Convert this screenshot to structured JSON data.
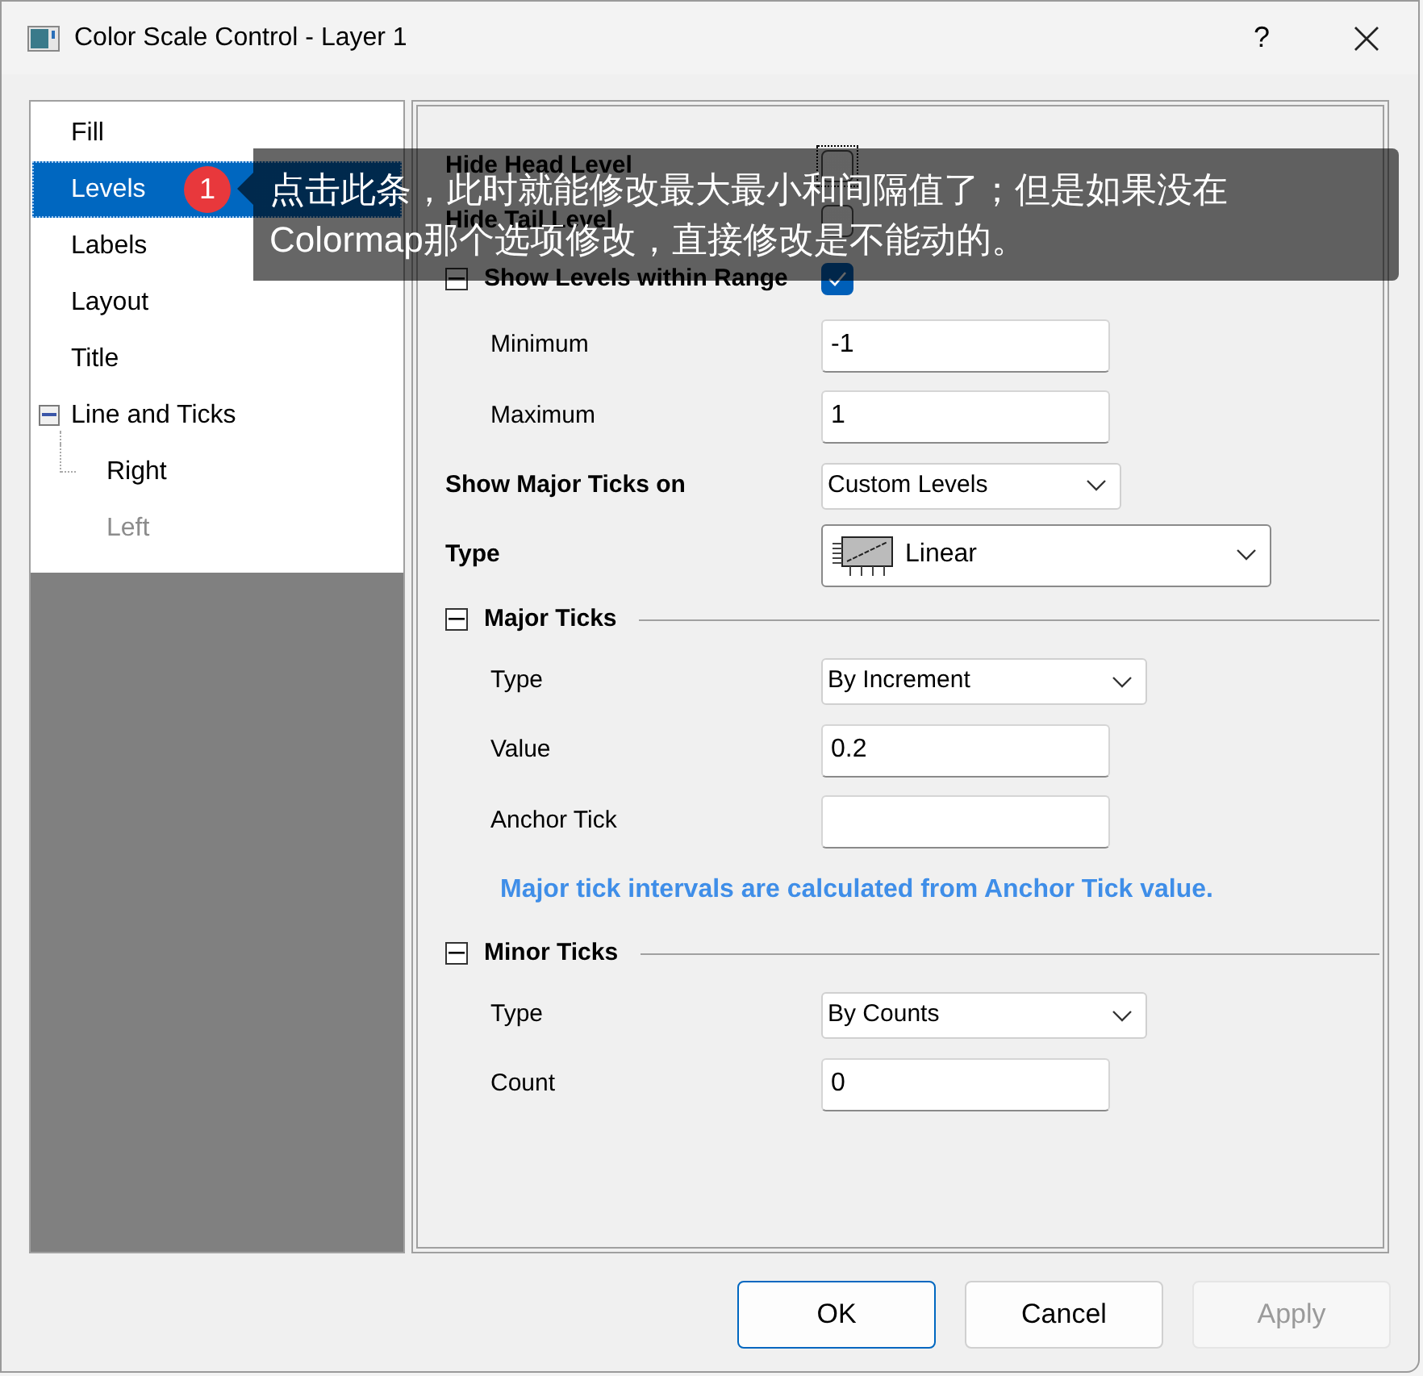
{
  "window": {
    "title": "Color Scale Control - Layer 1",
    "help": "?"
  },
  "tree": [
    {
      "label": "Fill",
      "selected": false,
      "disabled": false
    },
    {
      "label": "Levels",
      "selected": true,
      "disabled": false
    },
    {
      "label": "Labels",
      "selected": false,
      "disabled": false
    },
    {
      "label": "Layout",
      "selected": false,
      "disabled": false
    },
    {
      "label": "Title",
      "selected": false,
      "disabled": false
    },
    {
      "label": "Line and Ticks",
      "selected": false,
      "disabled": false,
      "expanded": true,
      "children": [
        {
          "label": "Right",
          "selected": false,
          "disabled": false
        },
        {
          "label": "Left",
          "selected": false,
          "disabled": true
        }
      ]
    }
  ],
  "properties": [
    {
      "kind": "checkbox",
      "label": "Hide Head Level",
      "checked": false,
      "focused": true
    },
    {
      "kind": "checkbox",
      "label": "Hide Tail Level",
      "checked": false,
      "focused": false
    },
    {
      "kind": "check-section",
      "label": "Show Levels within Range",
      "expanded": true,
      "checked": true,
      "children": [
        {
          "kind": "input",
          "label": "Minimum",
          "value": "-1"
        },
        {
          "kind": "input",
          "label": "Maximum",
          "value": "1"
        }
      ]
    },
    {
      "kind": "select",
      "label": "Show Major Ticks on",
      "value": "Custom Levels"
    },
    {
      "kind": "type-select",
      "label": "Type",
      "value": "Linear"
    },
    {
      "kind": "section",
      "label": "Major Ticks",
      "expanded": true,
      "children": [
        {
          "kind": "select",
          "label": "Type",
          "value": "By Increment"
        },
        {
          "kind": "input",
          "label": "Value",
          "value": "0.2"
        },
        {
          "kind": "input",
          "label": "Anchor Tick"
        },
        {
          "kind": "note",
          "label": "Major tick intervals are calculated from Anchor Tick value."
        }
      ]
    },
    {
      "kind": "section",
      "label": "Minor Ticks",
      "expanded": true,
      "children": [
        {
          "kind": "select",
          "label": "Type",
          "value": "By Counts"
        },
        {
          "kind": "input",
          "label": "Count",
          "value": "0"
        }
      ]
    }
  ],
  "tooltip": {
    "badge": "1",
    "lines": [
      "点击此条，此时就能修改最大最小和间隔值了；但是如果没在",
      "Colormap那个选项修改，直接修改是不能动的。"
    ]
  },
  "buttons": [
    {
      "label": "OK",
      "default": true,
      "disabled": false
    },
    {
      "label": "Cancel",
      "default": false,
      "disabled": false
    },
    {
      "label": "Apply",
      "default": false,
      "disabled": true
    }
  ]
}
